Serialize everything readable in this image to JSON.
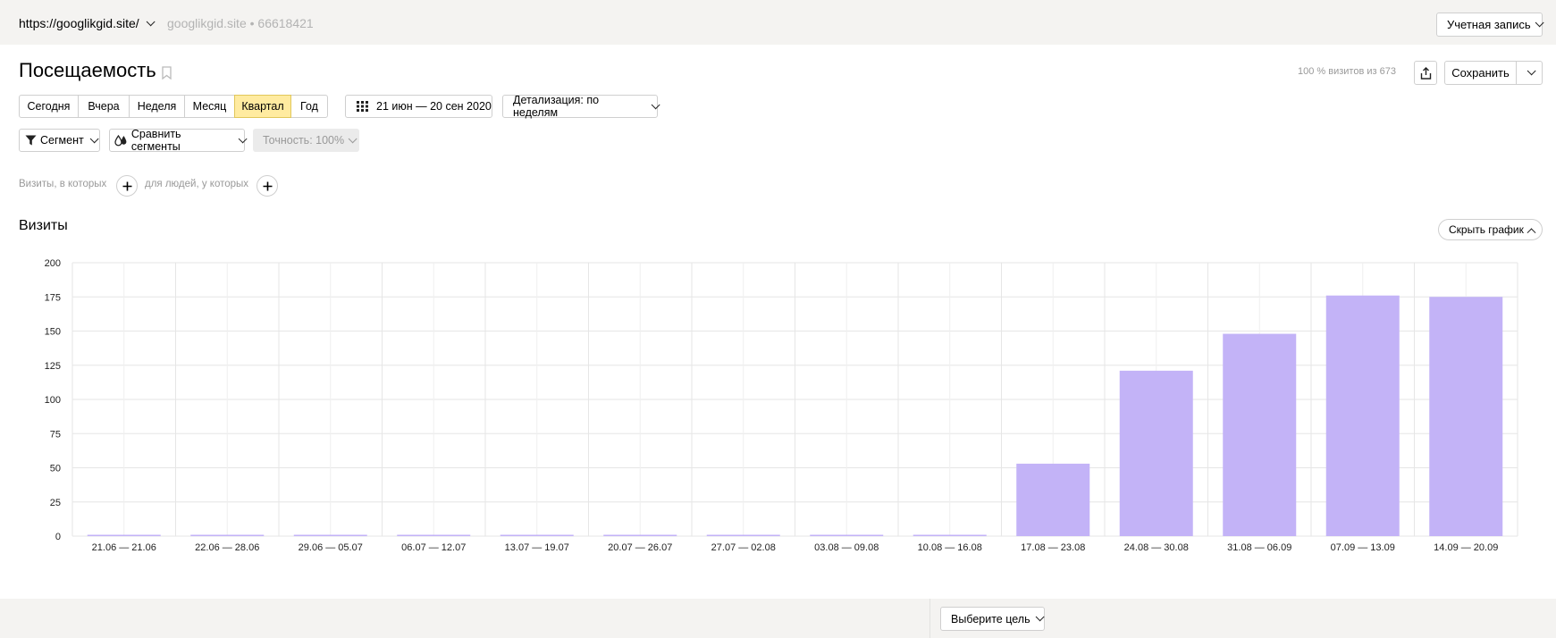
{
  "header": {
    "site_url": "https://googlikgid.site/",
    "site_meta": "googlikgid.site • 66618421",
    "account_label": "Учетная запись"
  },
  "report": {
    "title": "Посещаемость",
    "visits_summary": "100 % визитов из 673",
    "save_label": "Сохранить"
  },
  "periods": [
    {
      "label": "Сегодня",
      "active": false
    },
    {
      "label": "Вчера",
      "active": false
    },
    {
      "label": "Неделя",
      "active": false
    },
    {
      "label": "Месяц",
      "active": false
    },
    {
      "label": "Квартал",
      "active": true
    },
    {
      "label": "Год",
      "active": false
    }
  ],
  "date_range": "21 июн — 20 сен 2020",
  "detail_label": "Детализация: по неделям",
  "filters": {
    "segment_label": "Сегмент",
    "compare_label": "Сравнить сегменты",
    "accuracy_label": "Точность: 100%",
    "visits_where": "Визиты, в которых",
    "people_where": "для людей, у которых"
  },
  "chart_section": {
    "title": "Визиты",
    "hide_label": "Скрыть график"
  },
  "bottom": {
    "goal_label": "Выберите цель"
  },
  "colors": {
    "bar": "#c3b3f7",
    "active_period": "#ffeba0",
    "grid": "#e6e6e6"
  },
  "chart_data": {
    "type": "bar",
    "title": "Визиты",
    "categories": [
      "21.06 — 21.06",
      "22.06 — 28.06",
      "29.06 — 05.07",
      "06.07 — 12.07",
      "13.07 — 19.07",
      "20.07 — 26.07",
      "27.07 — 02.08",
      "03.08 — 09.08",
      "10.08 — 16.08",
      "17.08 — 23.08",
      "24.08 — 30.08",
      "31.08 — 06.09",
      "07.09 — 13.09",
      "14.09 — 20.09"
    ],
    "values": [
      1,
      1,
      1,
      1,
      1,
      1,
      1,
      1,
      1,
      53,
      121,
      148,
      176,
      175
    ],
    "yticks": [
      0,
      25,
      50,
      75,
      100,
      125,
      150,
      175,
      200
    ],
    "ylim": [
      0,
      200
    ],
    "grid": true
  }
}
